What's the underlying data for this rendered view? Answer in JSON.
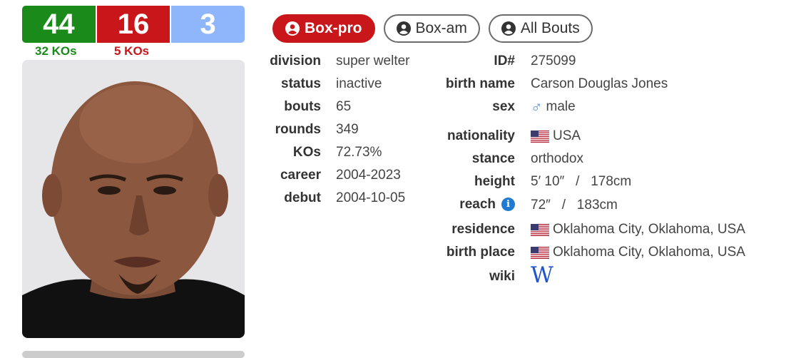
{
  "record": {
    "wins": "44",
    "losses": "16",
    "draws": "3",
    "wins_kos": "32 KOs",
    "losses_kos": "5 KOs"
  },
  "tabs": [
    {
      "label": "Box-pro",
      "active": true
    },
    {
      "label": "Box-am",
      "active": false
    },
    {
      "label": "All Bouts",
      "active": false
    }
  ],
  "left_info": [
    {
      "label": "division",
      "value": "super welter"
    },
    {
      "label": "status",
      "value": "inactive"
    },
    {
      "label": "bouts",
      "value": "65"
    },
    {
      "label": "rounds",
      "value": "349"
    },
    {
      "label": "KOs",
      "value": "72.73%"
    },
    {
      "label": "career",
      "value": "2004-2023"
    },
    {
      "label": "debut",
      "value": "2004-10-05"
    }
  ],
  "right_info": {
    "id": {
      "label": "ID#",
      "value": "275099"
    },
    "birth_name": {
      "label": "birth name",
      "value": "Carson Douglas Jones"
    },
    "sex": {
      "label": "sex",
      "value": "male",
      "icon": "male-icon"
    },
    "nationality": {
      "label": "nationality",
      "value": "USA",
      "icon": "us-flag-icon"
    },
    "stance": {
      "label": "stance",
      "value": "orthodox"
    },
    "height": {
      "label": "height",
      "value": "5′ 10″   /   178cm"
    },
    "reach": {
      "label": "reach",
      "value": "72″   /   183cm",
      "info_icon": "i"
    },
    "residence": {
      "label": "residence",
      "value": "Oklahoma City, Oklahoma, USA",
      "icon": "us-flag-icon"
    },
    "birth_place": {
      "label": "birth place",
      "value": "Oklahoma City, Oklahoma, USA",
      "icon": "us-flag-icon"
    },
    "wiki": {
      "label": "wiki",
      "value": "W",
      "icon": "wikipedia-icon"
    }
  },
  "colors": {
    "win": "#1a8a1a",
    "loss": "#c9161a",
    "draw": "#8fb6fa",
    "tab_active": "#c9161a"
  }
}
